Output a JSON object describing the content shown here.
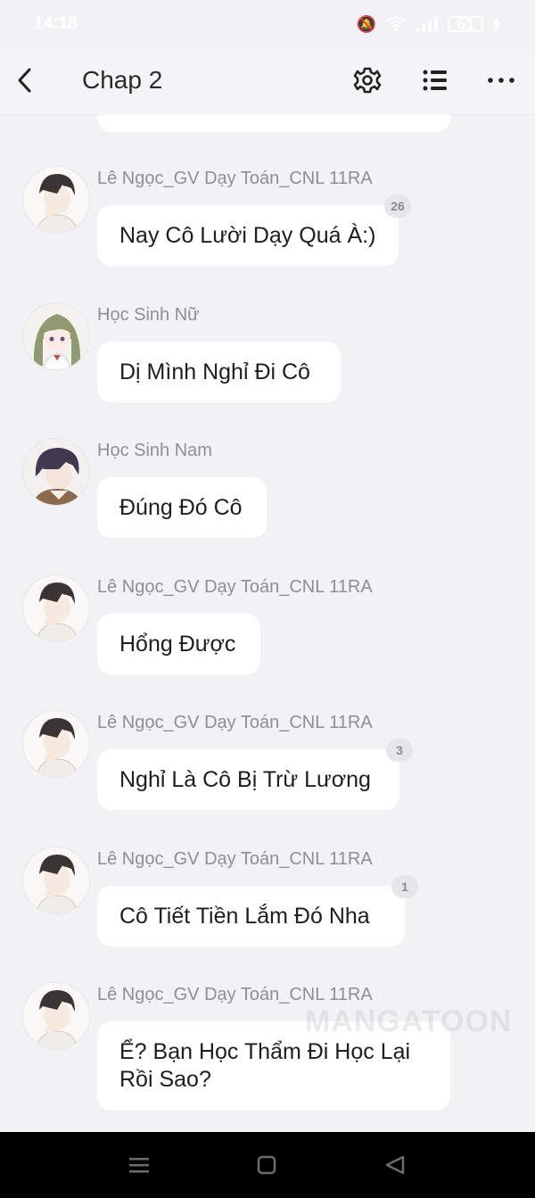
{
  "status_bar": {
    "time": "14:18",
    "icons": [
      "mute-icon",
      "wifi-icon",
      "signal-icon",
      "battery-icon",
      "charging-icon"
    ],
    "battery_level": "61"
  },
  "header": {
    "title": "Chap 2",
    "icons": [
      "back-arrow-icon",
      "gear-icon",
      "list-icon",
      "more-icon"
    ]
  },
  "messages": [
    {
      "sender": "Lê Ngọc_GV Dạy Toán_CNL 11RA",
      "text": "Nay Cô Lười Dạy Quá À:)",
      "badge": "26",
      "avatar": "teacher-avatar"
    },
    {
      "sender": "Học Sinh Nữ",
      "text": "Dị Mình Nghỉ Đi Cô",
      "badge": "",
      "avatar": "girl-student-avatar"
    },
    {
      "sender": "Học Sinh Nam",
      "text": "Đúng Đó Cô",
      "badge": "",
      "avatar": "boy-student-avatar"
    },
    {
      "sender": "Lê Ngọc_GV Dạy Toán_CNL 11RA",
      "text": "Hổng Được",
      "badge": "",
      "avatar": "teacher-avatar"
    },
    {
      "sender": "Lê Ngọc_GV Dạy Toán_CNL 11RA",
      "text": "Nghỉ Là Cô Bị Trừ Lương",
      "badge": "3",
      "avatar": "teacher-avatar"
    },
    {
      "sender": "Lê Ngọc_GV Dạy Toán_CNL 11RA",
      "text": "Cô Tiết Tiền Lắm Đó Nha",
      "badge": "1",
      "avatar": "teacher-avatar"
    },
    {
      "sender": "Lê Ngọc_GV Dạy Toán_CNL 11RA",
      "text": "Ể? Bạn Học Thẩm Đi Học Lại Rồi Sao?",
      "badge": "",
      "avatar": "teacher-avatar"
    }
  ],
  "watermark": "MANGATOON",
  "nav_bar": {
    "icons": [
      "recent-apps-icon",
      "home-icon",
      "back-icon"
    ]
  },
  "colors": {
    "background": "#f2f2f5",
    "bubble": "#ffffff",
    "sender": "#8e8e95",
    "badge": "#e6e6ea"
  }
}
